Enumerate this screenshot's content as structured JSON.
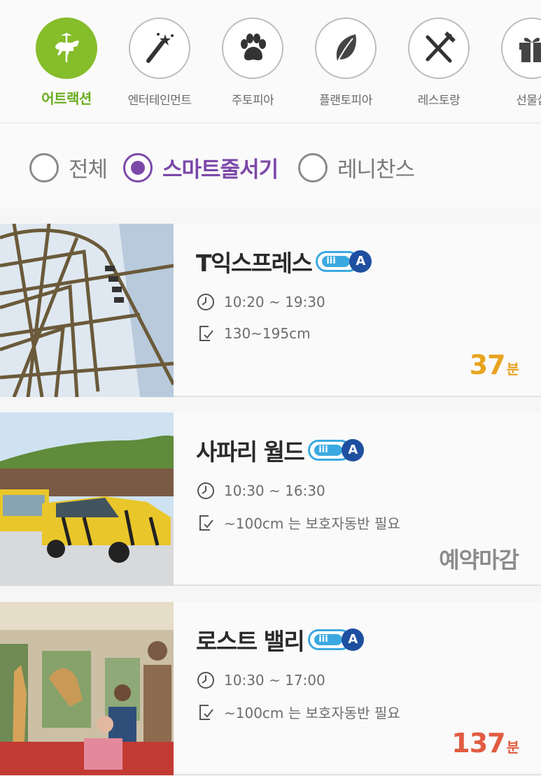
{
  "categories": [
    {
      "label": "어트랙션",
      "icon": "carousel-horse-icon",
      "active": true
    },
    {
      "label": "엔터테인먼트",
      "icon": "magic-wand-icon",
      "active": false
    },
    {
      "label": "주토피아",
      "icon": "paw-icon",
      "active": false
    },
    {
      "label": "플랜토피아",
      "icon": "leaf-icon",
      "active": false
    },
    {
      "label": "레스토랑",
      "icon": "fork-knife-icon",
      "active": false
    },
    {
      "label": "선물샵",
      "icon": "gift-icon",
      "active": false
    }
  ],
  "filters": [
    {
      "label": "전체",
      "selected": false
    },
    {
      "label": "스마트줄서기",
      "selected": true
    },
    {
      "label": "레니찬스",
      "selected": false
    }
  ],
  "attractions": [
    {
      "title": "T익스프레스",
      "badge": "A",
      "hours": "10:20 ~ 19:30",
      "height": "130~195cm",
      "status_value": "37",
      "status_unit": "분",
      "status_type": "wait-ok"
    },
    {
      "title": "사파리 월드",
      "badge": "A",
      "hours": "10:30 ~ 16:30",
      "height": "~100cm 는 보호자동반 필요",
      "status_value": "예약마감",
      "status_unit": "",
      "status_type": "closed"
    },
    {
      "title": "로스트 밸리",
      "badge": "A",
      "hours": "10:30 ~ 17:00",
      "height": "~100cm 는 보호자동반 필요",
      "status_value": "137",
      "status_unit": "분",
      "status_type": "wait-long"
    }
  ],
  "badge_pill_text": "iii",
  "colors": {
    "brand_green": "#86bd2b",
    "accent_purple": "#7b48a8",
    "wait_yellow": "#e8a420",
    "wait_red": "#e05c41",
    "badge_blue": "#3ba9e0"
  }
}
